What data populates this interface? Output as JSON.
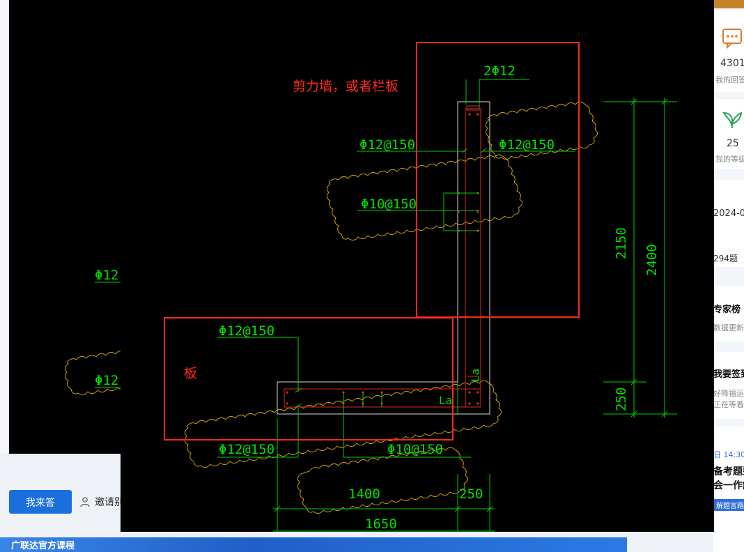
{
  "page": {
    "answer_button": "我来答",
    "invite_label": "邀请别",
    "banner_text": "广联达官方课程"
  },
  "sidebar": {
    "answers_count": "4301",
    "answers_label": "我的回答",
    "level_count": "25",
    "level_label": "我的等级",
    "date_partial": "2024-0",
    "questions_partial": "294题",
    "expert_title": "专家榜",
    "expert_sub": "数据更新时",
    "signin_title": "我要签到",
    "signin_sub1": "好降福运也",
    "signin_sub2": "正在等着你",
    "time_partial": "日 14:30",
    "exam_line1": "备考题型",
    "exam_line2": "会一作解",
    "exam_tag": "解题言路"
  },
  "cad": {
    "annotation_wall": "剪力墙，或者栏板",
    "annotation_slab": "板",
    "rebar_2phi12": "2Φ12",
    "rebar_phi12_150": "Φ12@150",
    "rebar_phi10_150": "Φ10@150",
    "rebar_phi12_150_b": "Φ12@150",
    "rebar_phi12_150_c": "Φ12@150",
    "rebar_phi10_150_b": "Φ10@150",
    "rebar_phi12_150_d": "Φ12@150",
    "rebar_phi12_left": "Φ12",
    "rebar_phi12_left2": "Φ12",
    "dim_2150": "2150",
    "dim_2400": "2400",
    "dim_250_v": "250",
    "dim_1400": "1400",
    "dim_250_h": "250",
    "dim_1650": "1650",
    "la_v": "La",
    "la_h": "La"
  },
  "colors": {
    "cad_green": "#00e000",
    "cad_red": "#ff2a1a",
    "cad_cloud": "#c8a000",
    "cad_outline": "#d8d8d8",
    "primary_button": "#1a6fdc"
  }
}
